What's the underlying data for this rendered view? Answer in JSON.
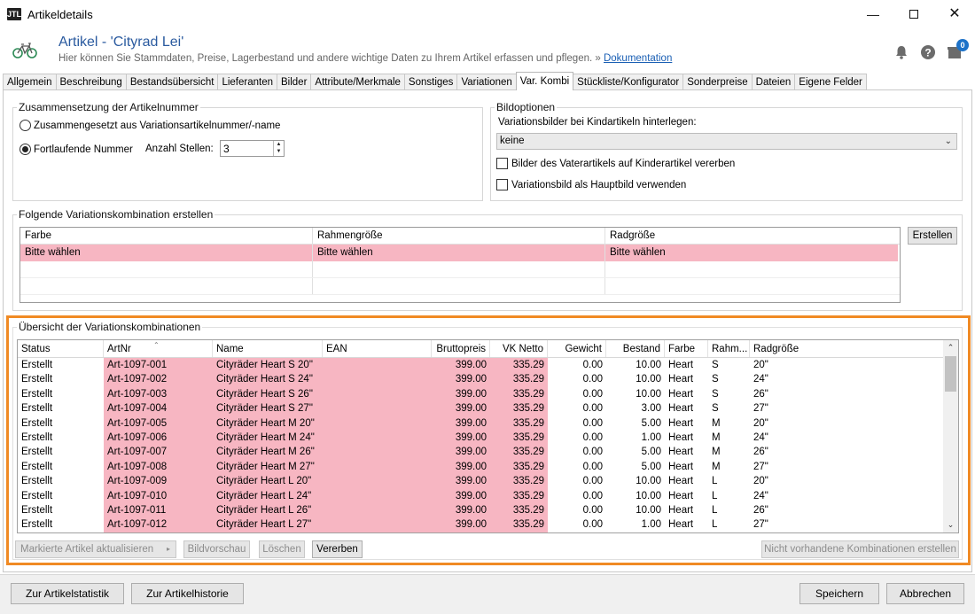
{
  "window": {
    "title": "Artikeldetails",
    "app_icon_text": "JTL"
  },
  "header": {
    "title": "Artikel - 'Cityrad Lei'",
    "subtitle": "Hier können Sie Stammdaten, Preise, Lagerbestand und andere wichtige Daten zu Ihrem Artikel erfassen und pflegen. »",
    "doc_link": "Dokumentation",
    "notification_count": "0"
  },
  "tabs": [
    {
      "label": "Allgemein"
    },
    {
      "label": "Beschreibung"
    },
    {
      "label": "Bestandsübersicht"
    },
    {
      "label": "Lieferanten"
    },
    {
      "label": "Bilder"
    },
    {
      "label": "Attribute/Merkmale"
    },
    {
      "label": "Sonstiges"
    },
    {
      "label": "Variationen"
    },
    {
      "label": "Var. Kombi",
      "active": true
    },
    {
      "label": "Stückliste/Konfigurator"
    },
    {
      "label": "Sonderpreise"
    },
    {
      "label": "Dateien"
    },
    {
      "label": "Eigene Felder"
    }
  ],
  "artikelnummer": {
    "title": "Zusammensetzung der Artikelnummer",
    "option_composed": "Zusammengesetzt aus Variationsartikelnummer/-name",
    "option_sequential": "Fortlaufende Nummer",
    "digits_label": "Anzahl Stellen:",
    "digits_value": "3"
  },
  "bildoptionen": {
    "title": "Bildoptionen",
    "select_label": "Variationsbilder bei Kindartikeln hinterlegen:",
    "select_value": "keine",
    "check_inherit": "Bilder des Vaterartikels auf Kinderartikel vererben",
    "check_main": "Variationsbild als Hauptbild verwenden"
  },
  "create_combo": {
    "title": "Folgende Variationskombination erstellen",
    "columns": [
      "Farbe",
      "Rahmengröße",
      "Radgröße"
    ],
    "row": [
      "Bitte wählen",
      "Bitte wählen",
      "Bitte wählen"
    ],
    "button": "Erstellen"
  },
  "overview": {
    "title": "Übersicht der Variationskombinationen",
    "columns": [
      "Status",
      "ArtNr",
      "Name",
      "EAN",
      "Bruttopreis",
      "VK Netto",
      "Gewicht",
      "Bestand",
      "Farbe",
      "Rahm...",
      "Radgröße"
    ],
    "rows": [
      [
        "Erstellt",
        "Art-1097-001",
        "Cityräder Heart S 20\"",
        "",
        "399.00",
        "335.29",
        "0.00",
        "10.00",
        "Heart",
        "S",
        "20\""
      ],
      [
        "Erstellt",
        "Art-1097-002",
        "Cityräder Heart S 24\"",
        "",
        "399.00",
        "335.29",
        "0.00",
        "10.00",
        "Heart",
        "S",
        "24\""
      ],
      [
        "Erstellt",
        "Art-1097-003",
        "Cityräder Heart S 26\"",
        "",
        "399.00",
        "335.29",
        "0.00",
        "10.00",
        "Heart",
        "S",
        "26\""
      ],
      [
        "Erstellt",
        "Art-1097-004",
        "Cityräder Heart S 27\"",
        "",
        "399.00",
        "335.29",
        "0.00",
        "3.00",
        "Heart",
        "S",
        "27\""
      ],
      [
        "Erstellt",
        "Art-1097-005",
        "Cityräder Heart M 20\"",
        "",
        "399.00",
        "335.29",
        "0.00",
        "5.00",
        "Heart",
        "M",
        "20\""
      ],
      [
        "Erstellt",
        "Art-1097-006",
        "Cityräder Heart M 24\"",
        "",
        "399.00",
        "335.29",
        "0.00",
        "1.00",
        "Heart",
        "M",
        "24\""
      ],
      [
        "Erstellt",
        "Art-1097-007",
        "Cityräder Heart M 26\"",
        "",
        "399.00",
        "335.29",
        "0.00",
        "5.00",
        "Heart",
        "M",
        "26\""
      ],
      [
        "Erstellt",
        "Art-1097-008",
        "Cityräder Heart M 27\"",
        "",
        "399.00",
        "335.29",
        "0.00",
        "5.00",
        "Heart",
        "M",
        "27\""
      ],
      [
        "Erstellt",
        "Art-1097-009",
        "Cityräder Heart L 20\"",
        "",
        "399.00",
        "335.29",
        "0.00",
        "10.00",
        "Heart",
        "L",
        "20\""
      ],
      [
        "Erstellt",
        "Art-1097-010",
        "Cityräder Heart L 24\"",
        "",
        "399.00",
        "335.29",
        "0.00",
        "10.00",
        "Heart",
        "L",
        "24\""
      ],
      [
        "Erstellt",
        "Art-1097-011",
        "Cityräder Heart L 26\"",
        "",
        "399.00",
        "335.29",
        "0.00",
        "10.00",
        "Heart",
        "L",
        "26\""
      ],
      [
        "Erstellt",
        "Art-1097-012",
        "Cityräder Heart L 27\"",
        "",
        "399.00",
        "335.29",
        "0.00",
        "1.00",
        "Heart",
        "L",
        "27\""
      ]
    ],
    "buttons": {
      "update": "Markierte Artikel aktualisieren",
      "preview": "Bildvorschau",
      "delete": "Löschen",
      "inherit": "Vererben",
      "create_missing": "Nicht vorhandene Kombinationen erstellen"
    }
  },
  "footer": {
    "stats": "Zur Artikelstatistik",
    "history": "Zur Artikelhistorie",
    "save": "Speichern",
    "cancel": "Abbrechen"
  },
  "colors": {
    "highlight_pink": "#f7b6c2",
    "frame_orange": "#f08a24",
    "title_blue": "#2a5a9f"
  }
}
